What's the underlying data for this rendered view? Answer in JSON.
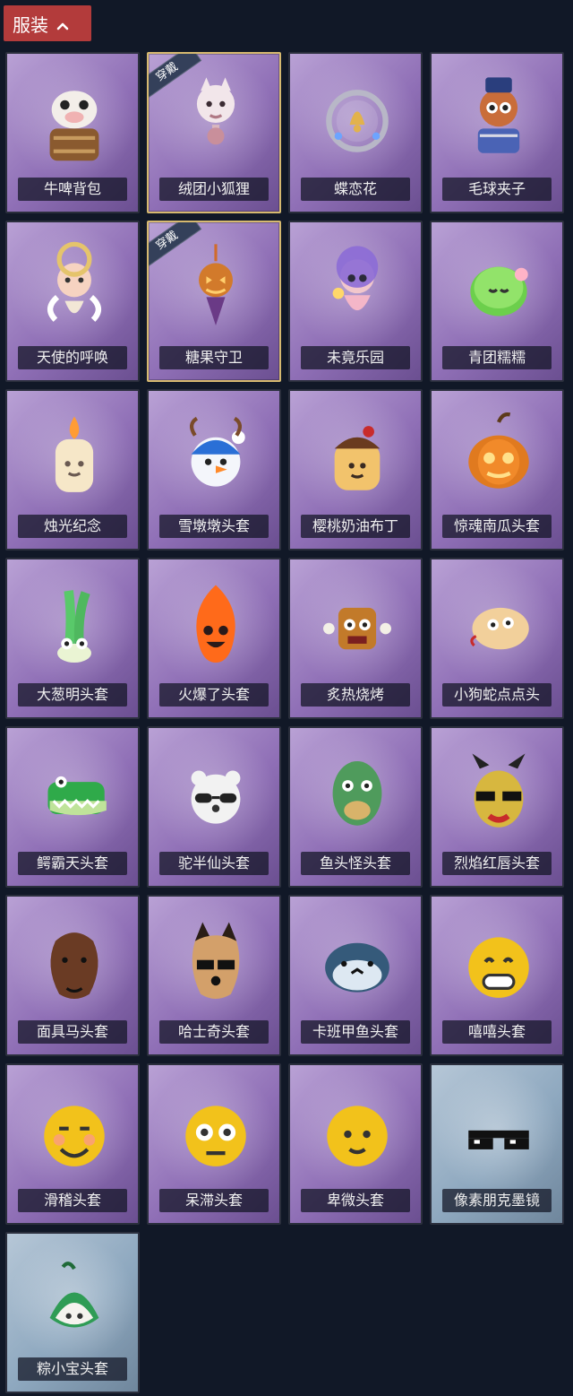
{
  "section": {
    "title": "服装",
    "toggle_icon": "chevron-up-icon"
  },
  "badge_label": "穿戴",
  "items": [
    {
      "label": "牛啤背包",
      "icon": "cow-barrel-icon",
      "rarity": "purple",
      "equipped": false
    },
    {
      "label": "绒团小狐狸",
      "icon": "fox-icon",
      "rarity": "purple",
      "equipped": true
    },
    {
      "label": "蝶恋花",
      "icon": "bell-wreath-icon",
      "rarity": "purple",
      "equipped": false
    },
    {
      "label": "毛球夹子",
      "icon": "raccoon-drum-icon",
      "rarity": "purple",
      "equipped": false
    },
    {
      "label": "天使的呼唤",
      "icon": "angel-icon",
      "rarity": "purple",
      "equipped": false
    },
    {
      "label": "糖果守卫",
      "icon": "pumpkin-charm-icon",
      "rarity": "purple",
      "equipped": true
    },
    {
      "label": "未竟乐园",
      "icon": "doll-icon",
      "rarity": "purple",
      "equipped": false
    },
    {
      "label": "青团糯糯",
      "icon": "green-mochi-icon",
      "rarity": "purple",
      "equipped": false
    },
    {
      "label": "烛光纪念",
      "icon": "candle-icon",
      "rarity": "purple",
      "equipped": false
    },
    {
      "label": "雪墩墩头套",
      "icon": "snowman-hat-icon",
      "rarity": "purple",
      "equipped": false
    },
    {
      "label": "樱桃奶油布丁",
      "icon": "pudding-icon",
      "rarity": "purple",
      "equipped": false
    },
    {
      "label": "惊魂南瓜头套",
      "icon": "pumpkin-icon",
      "rarity": "purple",
      "equipped": false
    },
    {
      "label": "大葱明头套",
      "icon": "scallion-icon",
      "rarity": "purple",
      "equipped": false
    },
    {
      "label": "火爆了头套",
      "icon": "fire-spirit-icon",
      "rarity": "purple",
      "equipped": false
    },
    {
      "label": "炙热烧烤",
      "icon": "bbq-icon",
      "rarity": "purple",
      "equipped": false
    },
    {
      "label": "小狗蛇点点头",
      "icon": "snake-icon",
      "rarity": "purple",
      "equipped": false
    },
    {
      "label": "鳄霸天头套",
      "icon": "crocodile-icon",
      "rarity": "purple",
      "equipped": false
    },
    {
      "label": "驼半仙头套",
      "icon": "bear-sunglasses-icon",
      "rarity": "purple",
      "equipped": false
    },
    {
      "label": "鱼头怪头套",
      "icon": "fish-head-icon",
      "rarity": "purple",
      "equipped": false
    },
    {
      "label": "烈焰红唇头套",
      "icon": "yellow-mask-icon",
      "rarity": "purple",
      "equipped": false
    },
    {
      "label": "面具马头套",
      "icon": "horse-mask-icon",
      "rarity": "purple",
      "equipped": false
    },
    {
      "label": "哈士奇头套",
      "icon": "dog-sunglasses-icon",
      "rarity": "purple",
      "equipped": false
    },
    {
      "label": "卡班甲鱼头套",
      "icon": "fish-icon",
      "rarity": "purple",
      "equipped": false
    },
    {
      "label": "嘻嘻头套",
      "icon": "grin-emoji-icon",
      "rarity": "purple",
      "equipped": false
    },
    {
      "label": "滑稽头套",
      "icon": "smirk-emoji-icon",
      "rarity": "purple",
      "equipped": false
    },
    {
      "label": "呆滞头套",
      "icon": "stare-emoji-icon",
      "rarity": "purple",
      "equipped": false
    },
    {
      "label": "卑微头套",
      "icon": "shy-emoji-icon",
      "rarity": "purple",
      "equipped": false
    },
    {
      "label": "像素朋克墨镜",
      "icon": "pixel-sunglasses-icon",
      "rarity": "blue",
      "equipped": false
    },
    {
      "label": "粽小宝头套",
      "icon": "zongzi-icon",
      "rarity": "blue",
      "equipped": false
    }
  ],
  "colors": {
    "background": "#111827",
    "header_red": "#b33b3b",
    "card_purple": "#8f6fb6",
    "card_blue": "#8ea8bf",
    "equipped_border": "#d6b96f",
    "label_bg": "#101422"
  }
}
